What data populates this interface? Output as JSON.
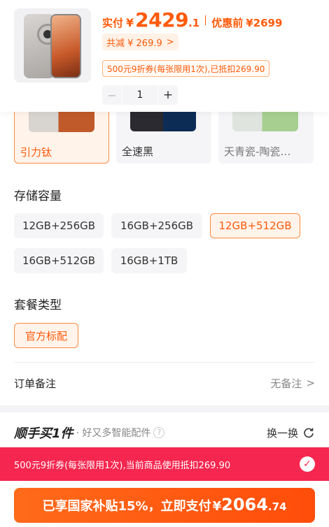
{
  "product": {
    "actual_label": "实付",
    "currency": "¥",
    "price_int": "2429",
    "price_dec": ".1",
    "orig_label": "优惠前",
    "orig_price": "¥2699",
    "discount_text": "共减 ¥ 269.9",
    "coupon_text": "500元9折券(每张限用1次),已抵扣269.90",
    "quantity": "1",
    "minus": "−",
    "plus": "+"
  },
  "colors": [
    {
      "label": "引力钛",
      "selected": true,
      "swatch": "#c98b65"
    },
    {
      "label": "全速黑",
      "selected": false,
      "swatch": "#1c1c22"
    },
    {
      "label": "天青瓷-陶瓷…",
      "selected": false,
      "swatch": "#c9d7c8"
    }
  ],
  "storage": {
    "title": "存储容量",
    "options": [
      {
        "label": "12GB+256GB",
        "selected": false
      },
      {
        "label": "16GB+256GB",
        "selected": false
      },
      {
        "label": "12GB+512GB",
        "selected": true
      },
      {
        "label": "16GB+512GB",
        "selected": false
      },
      {
        "label": "16GB+1TB",
        "selected": false
      }
    ]
  },
  "package": {
    "title": "套餐类型",
    "options": [
      {
        "label": "官方标配",
        "selected": true
      }
    ]
  },
  "remark": {
    "label": "订单备注",
    "value": "无备注"
  },
  "bundle": {
    "brand": "顺手买1件",
    "tag": "· 好又多智能配件",
    "help": "?",
    "refresh": "换一换"
  },
  "coupon_bar": {
    "text": "500元9折券(每张限用1次),当前商品使用抵扣269.90",
    "check": "✓"
  },
  "pay": {
    "text": "已享国家补贴15%，立即支付",
    "currency": "¥",
    "amount": "2064",
    "dec": ".74"
  },
  "colors_theme": {
    "accent": "#ff5a0a",
    "coupon_red": "#f5264f"
  }
}
